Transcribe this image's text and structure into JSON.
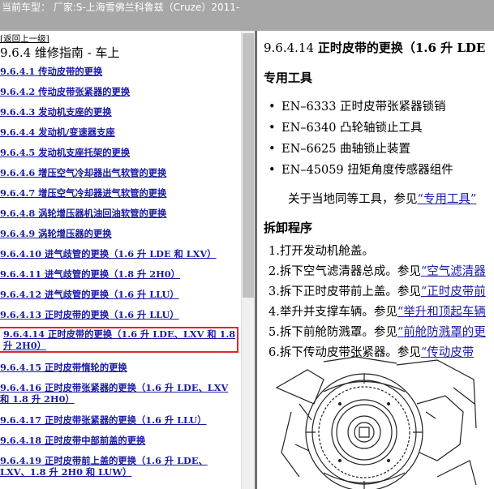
{
  "window": {
    "title": "当前车型： 厂家:S-上海雪佛兰科鲁兹（Cruze）2011-"
  },
  "left": {
    "back_label": "[返回上一级]",
    "section_title": "9.6.4 维修指南 - 车上",
    "items": [
      {
        "label": "9.6.4.1 传动皮带的更换"
      },
      {
        "label": "9.6.4.2 传动皮带张紧器的更换"
      },
      {
        "label": "9.6.4.3 发动机支座的更换"
      },
      {
        "label": "9.6.4.4 发动机/变速器支座"
      },
      {
        "label": "9.6.4.5 发动机支座托架的更换"
      },
      {
        "label": "9.6.4.6 增压空气冷却器出气软管的更换"
      },
      {
        "label": "9.6.4.7 增压空气冷却器进气软管的更换"
      },
      {
        "label": "9.6.4.8 涡轮增压器机油回油软管的更换"
      },
      {
        "label": "9.6.4.9 涡轮增压器的更换"
      },
      {
        "label": "9.6.4.10 进气歧管的更换（1.6 升 LDE 和 LXV）"
      },
      {
        "label": "9.6.4.11 进气歧管的更换（1.8 升 2H0）"
      },
      {
        "label": "9.6.4.12 进气歧管的更换（1.6 升 LLU）"
      },
      {
        "label": "9.6.4.13 正时皮带的更换（1.6 升 LLU）"
      },
      {
        "label": "9.6.4.14 正时皮带的更换（1.6 升 LDE、LXV 和 1.8 升 2H0）"
      },
      {
        "label": "9.6.4.15 正时皮带惰轮的更换"
      },
      {
        "label": "9.6.4.16 正时皮带张紧器的更换（1.6 升 LDE、LXV 和 1.8 升 2H0）"
      },
      {
        "label": "9.6.4.17 正时皮带张紧器的更换（1.6 升 LLU）"
      },
      {
        "label": "9.6.4.18 正时皮带中部前盖的更换"
      },
      {
        "label": "9.6.4.19 正时皮带前上盖的更换（1.6 升 LDE、LXV、1.8 升 2H0 和 LUW）"
      }
    ]
  },
  "right": {
    "title_num": "9.6.4.14",
    "title_text": "正时皮带的更换（1.6 升 LDE",
    "tools_heading": "专用工具",
    "tools": [
      {
        "text": "EN–6333 正时皮带张紧器锁销"
      },
      {
        "text": "EN–6340 凸轮轴锁止工具"
      },
      {
        "text": "EN–6625 曲轴锁止装置"
      },
      {
        "text": "EN–45059 扭矩角度传感器组件"
      }
    ],
    "ref_prefix": "关于当地同等工具，参见",
    "ref_link": "“专用工具”",
    "procedure_heading": "拆卸程序",
    "steps": [
      {
        "text": "1.打开发动机舱盖。",
        "link": ""
      },
      {
        "text": "2.拆下空气滤清器总成。参见",
        "link": "“空气滤清器"
      },
      {
        "text": "3.拆下正时皮带前上盖。参见",
        "link": "“正时皮带前"
      },
      {
        "text": "4.举升并支撑车辆。参见",
        "link": "“举升和顶起车辆"
      },
      {
        "text": "5.拆下前舱防溅罩。参见",
        "link": "“前舱防溅罩的更"
      },
      {
        "text": "6.拆下传动皮带张紧器。参见",
        "link": "“传动皮带"
      }
    ]
  },
  "colors": {
    "titlebar_bg": "#a7a7a7",
    "link": "#1a1aa6",
    "selection_outline": "#e0262a"
  }
}
